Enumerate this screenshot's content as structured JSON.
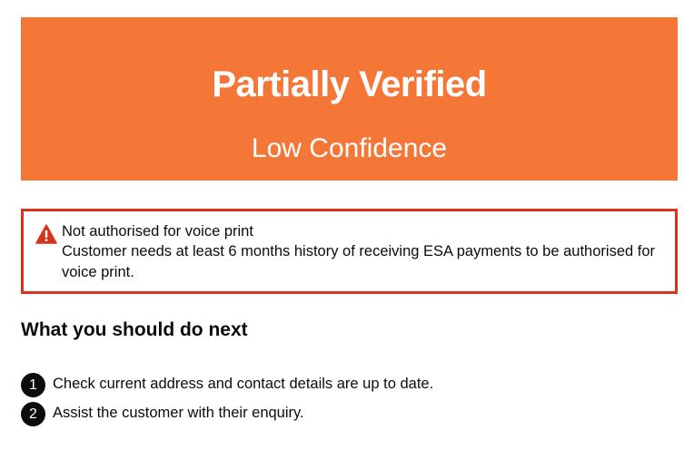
{
  "panel": {
    "title": "Partially Verified",
    "subtitle": "Low Confidence",
    "color": "#f47738"
  },
  "warning": {
    "icon": "warning-triangle-icon",
    "title": "Not authorised for voice print",
    "text": "Customer needs at least 6 months history of receiving ESA payments to be authorised for voice print.",
    "border_color": "#d4351c"
  },
  "next_steps": {
    "heading": "What you should do next",
    "steps": [
      {
        "number": "1",
        "text": "Check current address and contact details are up to date."
      },
      {
        "number": "2",
        "text": "Assist the customer with their enquiry."
      }
    ]
  }
}
